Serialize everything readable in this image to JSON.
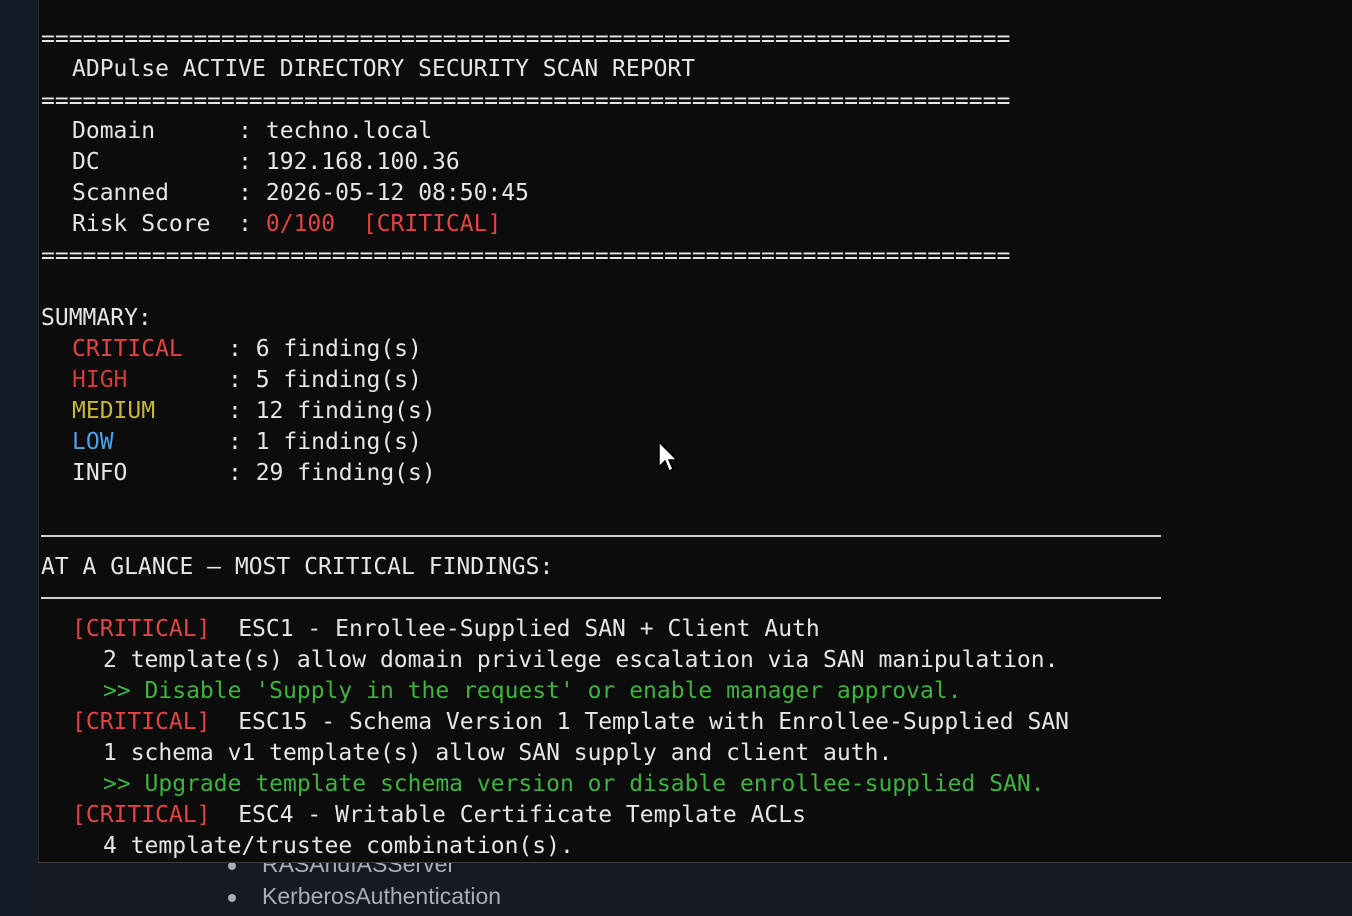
{
  "terminal": {
    "separator": "======================================================================",
    "report_title": "ADPulse ACTIVE DIRECTORY SECURITY SCAN REPORT",
    "fields": {
      "domain_label": "Domain      : ",
      "domain_value": "techno.local",
      "dc_label": "DC          : ",
      "dc_value": "192.168.100.36",
      "scanned_label": "Scanned     : ",
      "scanned_value": "2026-05-12 08:50:45",
      "risk_label": "Risk Score  : ",
      "risk_score": "0/100",
      "risk_level": "[CRITICAL]"
    },
    "summary": {
      "heading": "SUMMARY:",
      "rows": [
        {
          "label": "CRITICAL",
          "value": "6 finding(s)"
        },
        {
          "label": "HIGH",
          "value": "5 finding(s)"
        },
        {
          "label": "MEDIUM",
          "value": "12 finding(s)"
        },
        {
          "label": "LOW",
          "value": "1 finding(s)"
        },
        {
          "label": "INFO",
          "value": "29 finding(s)"
        }
      ]
    },
    "glance": {
      "heading": "AT A GLANCE — MOST CRITICAL FINDINGS:",
      "findings": [
        {
          "severity": "[CRITICAL]",
          "title": "ESC1 - Enrollee-Supplied SAN + Client Auth",
          "detail": "2 template(s) allow domain privilege escalation via SAN manipulation.",
          "fix": ">> Disable 'Supply in the request' or enable manager approval."
        },
        {
          "severity": "[CRITICAL]",
          "title": "ESC15 - Schema Version 1 Template with Enrollee-Supplied SAN",
          "detail": "1 schema v1 template(s) allow SAN supply and client auth.",
          "fix": ">> Upgrade template schema version or disable enrollee-supplied SAN."
        },
        {
          "severity": "[CRITICAL]",
          "title": "ESC4 - Writable Certificate Template ACLs",
          "detail": "4 template/trustee combination(s).",
          "fix": ""
        }
      ]
    }
  },
  "background_list": {
    "items": [
      "RASAndIASServer",
      "KerberosAuthentication"
    ]
  },
  "colors": {
    "critical": "#e04545",
    "high": "#d33b3b",
    "medium": "#c9b53a",
    "low": "#4ea0e6",
    "remediation": "#3fb33f",
    "terminal_bg": "#0c0c0c"
  }
}
